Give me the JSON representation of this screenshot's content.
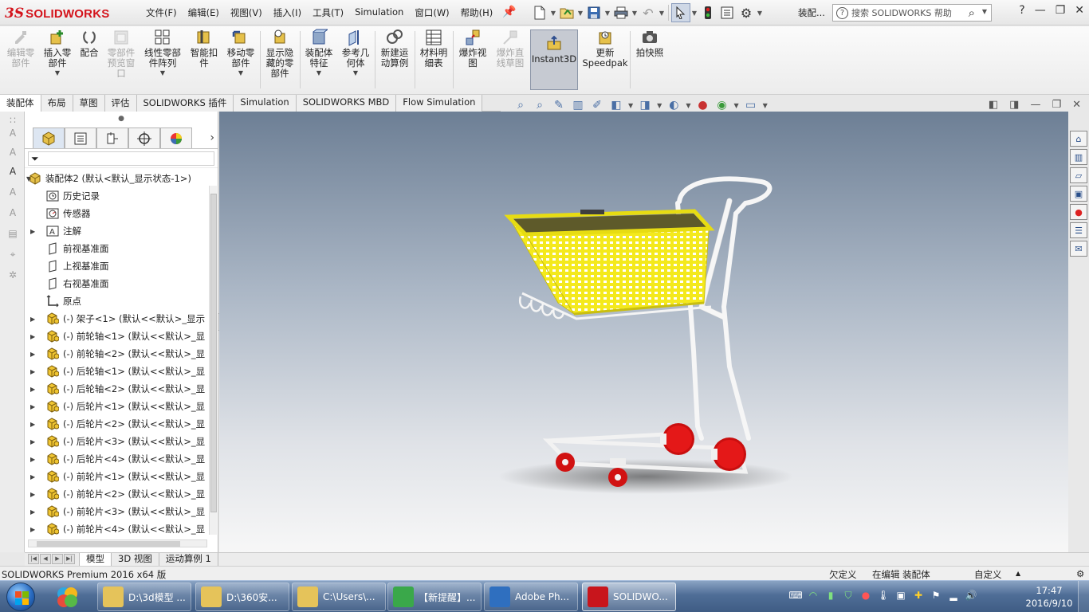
{
  "app": {
    "logo_text": "SOLIDWORKS",
    "menus": [
      "文件(F)",
      "编辑(E)",
      "视图(V)",
      "插入(I)",
      "工具(T)",
      "Simulation",
      "窗口(W)",
      "帮助(H)"
    ],
    "doc_title": "装配...",
    "search_placeholder": "搜索 SOLIDWORKS 帮助"
  },
  "ribbon": {
    "buttons": [
      {
        "label": "编辑零\n部件",
        "icon": "edit-component-icon",
        "enabled": false
      },
      {
        "label": "插入零\n部件",
        "icon": "insert-component-icon",
        "enabled": true,
        "dropdown": true
      },
      {
        "label": "配合",
        "icon": "mate-icon",
        "enabled": true
      },
      {
        "label": "零部件\n预览窗\n口",
        "icon": "component-preview-icon",
        "enabled": false
      },
      {
        "label": "线性零部\n件阵列",
        "icon": "linear-pattern-icon",
        "enabled": true,
        "dropdown": true
      },
      {
        "label": "智能扣\n件",
        "icon": "smart-fastener-icon",
        "enabled": true
      },
      {
        "label": "移动零\n部件",
        "icon": "move-component-icon",
        "enabled": true,
        "dropdown": true
      },
      {
        "label": "显示隐\n藏的零\n部件",
        "icon": "show-hidden-icon",
        "enabled": true
      },
      {
        "label": "装配体\n特征",
        "icon": "assembly-feature-icon",
        "enabled": true,
        "dropdown": true
      },
      {
        "label": "参考几\n何体",
        "icon": "reference-geometry-icon",
        "enabled": true,
        "dropdown": true
      },
      {
        "label": "新建运\n动算例",
        "icon": "motion-study-icon",
        "enabled": true
      },
      {
        "label": "材料明\n细表",
        "icon": "bom-icon",
        "enabled": true
      },
      {
        "label": "爆炸视\n图",
        "icon": "exploded-view-icon",
        "enabled": true
      },
      {
        "label": "爆炸直\n线草图",
        "icon": "explode-line-icon",
        "enabled": false
      },
      {
        "label": "Instant3D",
        "icon": "instant3d-icon",
        "enabled": true,
        "pressed": true
      },
      {
        "label": "更新\nSpeedpak",
        "icon": "speedpak-icon",
        "enabled": true
      },
      {
        "label": "拍快照",
        "icon": "snapshot-icon",
        "enabled": true
      }
    ]
  },
  "tabs": [
    "装配体",
    "布局",
    "草图",
    "评估",
    "SOLIDWORKS 插件",
    "Simulation",
    "SOLIDWORKS MBD",
    "Flow Simulation"
  ],
  "active_tab": "装配体",
  "tree": {
    "root": "装配体2  (默认<默认_显示状态-1>)",
    "items": [
      {
        "label": "历史记录",
        "icon": "history-icon",
        "expand": false
      },
      {
        "label": "传感器",
        "icon": "sensor-icon",
        "expand": false
      },
      {
        "label": "注解",
        "icon": "annotation-icon",
        "expand": true
      },
      {
        "label": "前视基准面",
        "icon": "plane-icon",
        "expand": false
      },
      {
        "label": "上视基准面",
        "icon": "plane-icon",
        "expand": false
      },
      {
        "label": "右视基准面",
        "icon": "plane-icon",
        "expand": false
      },
      {
        "label": "原点",
        "icon": "origin-icon",
        "expand": false
      },
      {
        "label": "(-) 架子<1> (默认<<默认>_显示",
        "icon": "part-icon",
        "expand": true
      },
      {
        "label": "(-) 前轮轴<1> (默认<<默认>_显",
        "icon": "part-icon",
        "expand": true
      },
      {
        "label": "(-) 前轮轴<2> (默认<<默认>_显",
        "icon": "part-icon",
        "expand": true
      },
      {
        "label": "(-) 后轮轴<1> (默认<<默认>_显",
        "icon": "part-icon",
        "expand": true
      },
      {
        "label": "(-) 后轮轴<2> (默认<<默认>_显",
        "icon": "part-icon",
        "expand": true
      },
      {
        "label": "(-) 后轮片<1> (默认<<默认>_显",
        "icon": "part-icon",
        "expand": true
      },
      {
        "label": "(-) 后轮片<2> (默认<<默认>_显",
        "icon": "part-icon",
        "expand": true
      },
      {
        "label": "(-) 后轮片<3> (默认<<默认>_显",
        "icon": "part-icon",
        "expand": true
      },
      {
        "label": "(-) 后轮片<4> (默认<<默认>_显",
        "icon": "part-icon",
        "expand": true
      },
      {
        "label": "(-) 前轮片<1> (默认<<默认>_显",
        "icon": "part-icon",
        "expand": true
      },
      {
        "label": "(-) 前轮片<2> (默认<<默认>_显",
        "icon": "part-icon",
        "expand": true
      },
      {
        "label": "(-) 前轮片<3> (默认<<默认>_显",
        "icon": "part-icon",
        "expand": true
      },
      {
        "label": "(-) 前轮片<4> (默认<<默认>_显",
        "icon": "part-icon",
        "expand": true
      }
    ]
  },
  "model_tabs": [
    "模型",
    "3D 视图",
    "运动算例 1"
  ],
  "active_model_tab": "模型",
  "status": {
    "product": "SOLIDWORKS Premium 2016 x64 版",
    "constraint": "欠定义",
    "mode": "在编辑 装配体",
    "units": "自定义"
  },
  "taskbar": {
    "items": [
      {
        "label": "D:\\3d模型 ...",
        "icon_color": "#e5c35a"
      },
      {
        "label": "D:\\360安...",
        "icon_color": "#e5c35a"
      },
      {
        "label": "C:\\Users\\...",
        "icon_color": "#e5c35a"
      },
      {
        "label": "【新提醒】...",
        "icon_color": "#3aa84a"
      },
      {
        "label": "Adobe Ph...",
        "icon_color": "#2f6fbf"
      },
      {
        "label": "SOLIDWO...",
        "icon_color": "#c8151c",
        "active": true
      }
    ],
    "time": "17:47",
    "date": "2016/9/10"
  },
  "colors": {
    "brand_red": "#d4131b",
    "basket_yellow": "#f4e91c",
    "wheel_red": "#d11212",
    "frame_white": "#f4f4f4"
  }
}
